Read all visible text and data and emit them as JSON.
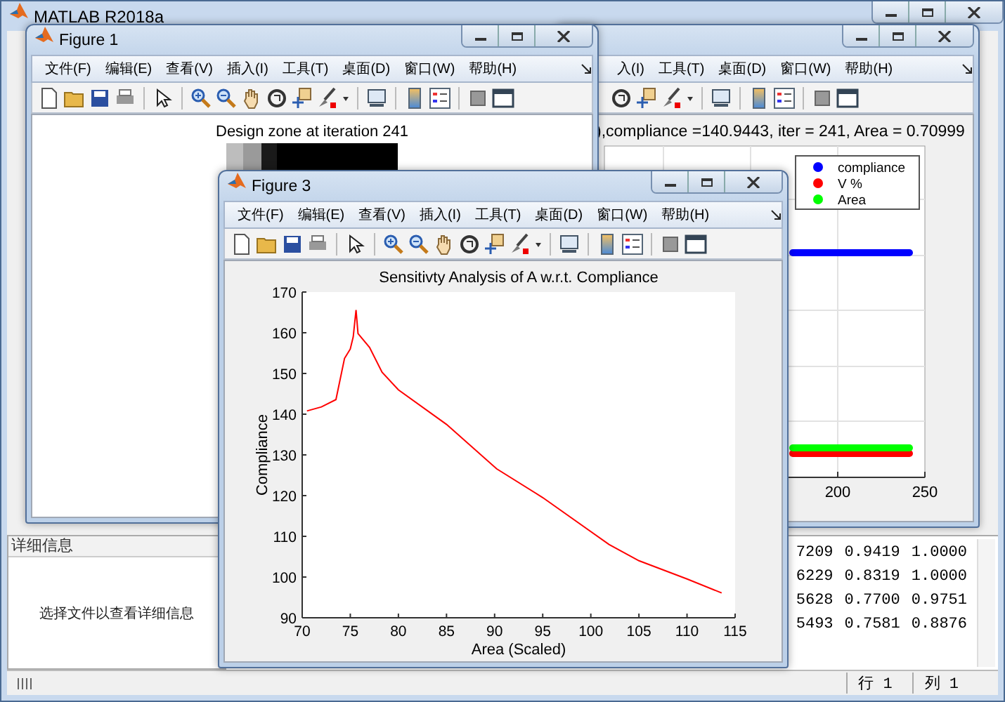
{
  "main_window": {
    "title": "MATLAB R2018a",
    "details_panel": {
      "header": "详细信息",
      "message": "选择文件以查看详细信息"
    },
    "command_output": {
      "rows": [
        [
          "7209",
          "0.9419",
          "1.0000"
        ],
        [
          "6229",
          "0.8319",
          "1.0000"
        ],
        [
          "5628",
          "0.7700",
          "0.9751"
        ],
        [
          "5493",
          "0.7581",
          "0.8876"
        ]
      ]
    },
    "status_bar": {
      "row": "行 1",
      "column": "列 1"
    }
  },
  "figures": [
    {
      "kind": "image",
      "title": "Figure 1",
      "menu": [
        "文件(F)",
        "编辑(E)",
        "查看(V)",
        "插入(I)",
        "工具(T)",
        "桌面(D)",
        "窗口(W)",
        "帮助(H)"
      ],
      "plot_title": "Design zone at iteration 241"
    },
    {
      "kind": "history_plot",
      "menu": [
        "入(I)",
        "工具(T)",
        "桌面(D)",
        "窗口(W)",
        "帮助(H)"
      ],
      "plot_title": "),compliance =140.9443, iter = 241, Area = 0.70999",
      "legend": [
        {
          "label": "compliance",
          "color": "#0000ff"
        },
        {
          "label": "V %",
          "color": "#ff0000"
        },
        {
          "label": "Area",
          "color": "#00ff00"
        }
      ],
      "xtick_labels": [
        "200",
        "250"
      ]
    },
    {
      "kind": "line_chart",
      "title": "Figure 3",
      "menu": [
        "文件(F)",
        "编辑(E)",
        "查看(V)",
        "插入(I)",
        "工具(T)",
        "桌面(D)",
        "窗口(W)",
        "帮助(H)"
      ],
      "chart_data": {
        "type": "line",
        "title": "Sensitivty Analysis of A w.r.t. Compliance",
        "xlabel": "Area (Scaled)",
        "ylabel": "Compliance",
        "x": [
          70.5,
          72,
          73.5,
          74.4,
          75,
          75.3,
          75.6,
          75.8,
          77,
          78.3,
          80,
          85,
          90.2,
          95,
          101.9,
          105,
          110,
          113.6
        ],
        "series": [
          {
            "color": "#ff0000",
            "values": [
              140.8,
              141.8,
              143.6,
              153.7,
              156,
              159,
              165.6,
              159.8,
              156.4,
              150.3,
              146,
              137.5,
              126.6,
              119.5,
              108,
              104,
              99.5,
              96.1
            ]
          }
        ],
        "xlim": [
          70,
          115
        ],
        "ylim": [
          90,
          170
        ],
        "xticks": [
          70,
          75,
          80,
          85,
          90,
          95,
          100,
          105,
          110,
          115
        ],
        "yticks": [
          90,
          100,
          110,
          120,
          130,
          140,
          150,
          160,
          170
        ]
      }
    }
  ]
}
